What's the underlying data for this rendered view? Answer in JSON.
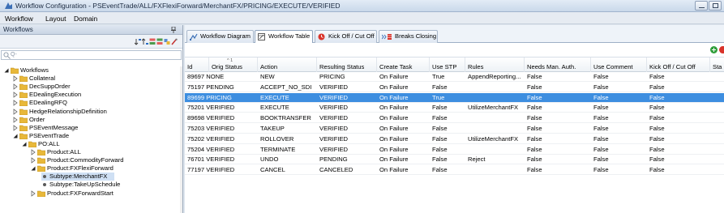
{
  "window": {
    "title": "Workflow Configuration - PSEventTrade/ALL/FXFlexiForward/MerchantFX/PRICING/EXECUTE/VERIFIED"
  },
  "menu": [
    "Workflow",
    "Layout",
    "Domain"
  ],
  "left_panel": {
    "title": "Workflows",
    "search_placeholder": "Q-",
    "tree": [
      {
        "label": "Workflows",
        "level": 0,
        "expander": "open",
        "icon": "folder"
      },
      {
        "label": "Collateral",
        "level": 1,
        "expander": "closed",
        "icon": "folder"
      },
      {
        "label": "DecSuppOrder",
        "level": 1,
        "expander": "closed",
        "icon": "folder"
      },
      {
        "label": "EDealingExecution",
        "level": 1,
        "expander": "closed",
        "icon": "folder"
      },
      {
        "label": "EDealingRFQ",
        "level": 1,
        "expander": "closed",
        "icon": "folder"
      },
      {
        "label": "HedgeRelationshipDefinition",
        "level": 1,
        "expander": "closed",
        "icon": "folder"
      },
      {
        "label": "Order",
        "level": 1,
        "expander": "closed",
        "icon": "folder"
      },
      {
        "label": "PSEventMessage",
        "level": 1,
        "expander": "closed",
        "icon": "folder"
      },
      {
        "label": "PSEventTrade",
        "level": 1,
        "expander": "open",
        "icon": "folder"
      },
      {
        "label": "PO:ALL",
        "level": 2,
        "expander": "open",
        "icon": "folder"
      },
      {
        "label": "Product:ALL",
        "level": 3,
        "expander": "closed",
        "icon": "folder"
      },
      {
        "label": "Product:CommodityForward",
        "level": 3,
        "expander": "closed",
        "icon": "folder"
      },
      {
        "label": "Product:FXFlexiForward",
        "level": 3,
        "expander": "open",
        "icon": "folder"
      },
      {
        "label": "Subtype:MerchantFX",
        "level": 4,
        "expander": "none",
        "icon": "bullet",
        "selected": true
      },
      {
        "label": "Subtype:TakeUpSchedule",
        "level": 4,
        "expander": "none",
        "icon": "bullet"
      },
      {
        "label": "Product:FXForwardStart",
        "level": 3,
        "expander": "closed",
        "icon": "folder"
      }
    ]
  },
  "tabs": [
    {
      "label": "Workflow Diagram",
      "icon": "diagram-icon"
    },
    {
      "label": "Workflow Table",
      "icon": "table-icon",
      "active": true
    },
    {
      "label": "Kick Off / Cut Off",
      "icon": "clock-icon"
    },
    {
      "label": "Breaks Closing",
      "icon": "breaks-icon"
    }
  ],
  "table": {
    "sort_indicator": "1",
    "columns": [
      "Id",
      "Orig Status",
      "Action",
      "Resulting Status",
      "Create Task",
      "Use STP",
      "Rules",
      "Needs Man. Auth.",
      "Use Comment",
      "Kick Off / Cut Off",
      "Sta"
    ],
    "rows": [
      [
        "89697",
        "NONE",
        "NEW",
        "PRICING",
        "On Failure",
        "True",
        "AppendReporting...",
        "False",
        "False",
        "False"
      ],
      [
        "75197",
        "PENDING",
        "ACCEPT_NO_SDI",
        "VERIFIED",
        "On Failure",
        "False",
        "",
        "False",
        "False",
        "False"
      ],
      [
        "89699",
        "PRICING",
        "EXECUTE",
        "VERIFIED",
        "On Failure",
        "True",
        "",
        "False",
        "False",
        "False"
      ],
      [
        "75201",
        "VERIFIED",
        "EXECUTE",
        "VERIFIED",
        "On Failure",
        "False",
        "UtilizeMerchantFX",
        "False",
        "False",
        "False"
      ],
      [
        "89698",
        "VERIFIED",
        "BOOKTRANSFER",
        "VERIFIED",
        "On Failure",
        "False",
        "",
        "False",
        "False",
        "False"
      ],
      [
        "75203",
        "VERIFIED",
        "TAKEUP",
        "VERIFIED",
        "On Failure",
        "False",
        "",
        "False",
        "False",
        "False"
      ],
      [
        "75202",
        "VERIFIED",
        "ROLLOVER",
        "VERIFIED",
        "On Failure",
        "False",
        "UtilizeMerchantFX",
        "False",
        "False",
        "False"
      ],
      [
        "75204",
        "VERIFIED",
        "TERMINATE",
        "VERIFIED",
        "On Failure",
        "False",
        "",
        "False",
        "False",
        "False"
      ],
      [
        "76701",
        "VERIFIED",
        "UNDO",
        "PENDING",
        "On Failure",
        "False",
        "Reject",
        "False",
        "False",
        "False"
      ],
      [
        "77197",
        "VERIFIED",
        "CANCEL",
        "CANCELED",
        "On Failure",
        "False",
        "",
        "False",
        "False",
        "False"
      ]
    ],
    "selected_row": 2
  },
  "colors": {
    "selection": "#3d8ee0",
    "folder": "#e8b83a",
    "add": "#2f9e3a",
    "remove": "#d9332a"
  }
}
